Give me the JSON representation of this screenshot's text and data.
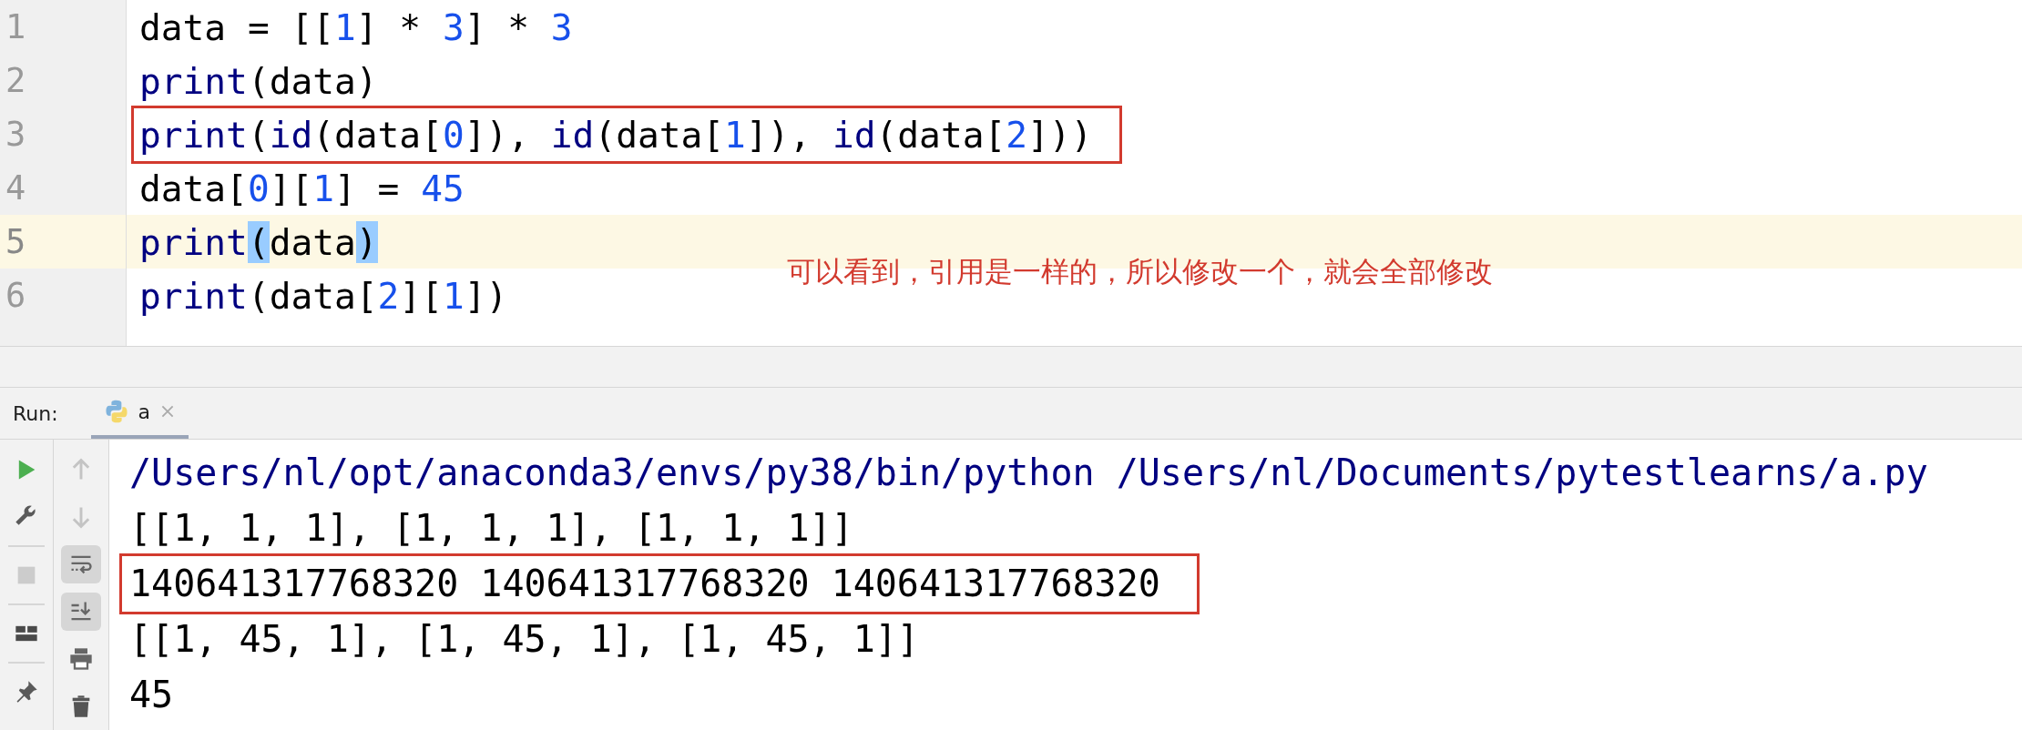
{
  "editor": {
    "lines": [
      {
        "number": "1",
        "current": false,
        "boxed": false,
        "tokens": [
          {
            "kind": "plain",
            "text": "data = [["
          },
          {
            "kind": "number",
            "text": "1"
          },
          {
            "kind": "plain",
            "text": "] * "
          },
          {
            "kind": "number",
            "text": "3"
          },
          {
            "kind": "plain",
            "text": "] * "
          },
          {
            "kind": "number",
            "text": "3"
          }
        ]
      },
      {
        "number": "2",
        "current": false,
        "boxed": false,
        "tokens": [
          {
            "kind": "builtin",
            "text": "print"
          },
          {
            "kind": "plain",
            "text": "(data)"
          }
        ]
      },
      {
        "number": "3",
        "current": false,
        "boxed": true,
        "tokens": [
          {
            "kind": "builtin",
            "text": "print"
          },
          {
            "kind": "plain",
            "text": "("
          },
          {
            "kind": "builtin",
            "text": "id"
          },
          {
            "kind": "plain",
            "text": "(data["
          },
          {
            "kind": "number",
            "text": "0"
          },
          {
            "kind": "plain",
            "text": "]), "
          },
          {
            "kind": "builtin",
            "text": "id"
          },
          {
            "kind": "plain",
            "text": "(data["
          },
          {
            "kind": "number",
            "text": "1"
          },
          {
            "kind": "plain",
            "text": "]), "
          },
          {
            "kind": "builtin",
            "text": "id"
          },
          {
            "kind": "plain",
            "text": "(data["
          },
          {
            "kind": "number",
            "text": "2"
          },
          {
            "kind": "plain",
            "text": "]))"
          }
        ]
      },
      {
        "number": "4",
        "current": false,
        "boxed": false,
        "tokens": [
          {
            "kind": "plain",
            "text": "data["
          },
          {
            "kind": "number",
            "text": "0"
          },
          {
            "kind": "plain",
            "text": "]["
          },
          {
            "kind": "number",
            "text": "1"
          },
          {
            "kind": "plain",
            "text": "] = "
          },
          {
            "kind": "number",
            "text": "45"
          }
        ]
      },
      {
        "number": "5",
        "current": true,
        "boxed": false,
        "tokens": [
          {
            "kind": "builtin",
            "text": "print"
          },
          {
            "kind": "matched",
            "text": "("
          },
          {
            "kind": "plain",
            "text": "data"
          },
          {
            "kind": "matched",
            "text": ")"
          }
        ]
      },
      {
        "number": "6",
        "current": false,
        "boxed": false,
        "tokens": [
          {
            "kind": "builtin",
            "text": "print"
          },
          {
            "kind": "plain",
            "text": "(data["
          },
          {
            "kind": "number",
            "text": "2"
          },
          {
            "kind": "plain",
            "text": "]["
          },
          {
            "kind": "number",
            "text": "1"
          },
          {
            "kind": "plain",
            "text": "])"
          }
        ]
      }
    ],
    "annotation": "可以看到，引用是一样的，所以修改一个，就会全部修改"
  },
  "run_panel": {
    "label": "Run:",
    "tabs": [
      {
        "label": "a",
        "selected": true
      }
    ],
    "tools_left": [
      {
        "kind": "run",
        "disabled": false
      },
      {
        "kind": "wrench",
        "disabled": false
      },
      {
        "kind": "stop",
        "disabled": true
      },
      {
        "kind": "layout",
        "disabled": false
      },
      {
        "kind": "pin",
        "disabled": false
      }
    ],
    "tools_right": [
      {
        "kind": "up",
        "on": false
      },
      {
        "kind": "down",
        "on": false
      },
      {
        "kind": "wrap",
        "on": true
      },
      {
        "kind": "scroll",
        "on": true
      },
      {
        "kind": "print",
        "on": false
      },
      {
        "kind": "trash",
        "on": false
      }
    ],
    "console": [
      {
        "kind": "command",
        "boxed": false,
        "text": "/Users/nl/opt/anaconda3/envs/py38/bin/python /Users/nl/Documents/pytestlearns/a.py"
      },
      {
        "kind": "output",
        "boxed": false,
        "text": "[[1, 1, 1], [1, 1, 1], [1, 1, 1]]"
      },
      {
        "kind": "output",
        "boxed": true,
        "text": "140641317768320 140641317768320 140641317768320"
      },
      {
        "kind": "output",
        "boxed": false,
        "text": "[[1, 45, 1], [1, 45, 1], [1, 45, 1]]"
      },
      {
        "kind": "output",
        "boxed": false,
        "text": "45"
      }
    ]
  }
}
